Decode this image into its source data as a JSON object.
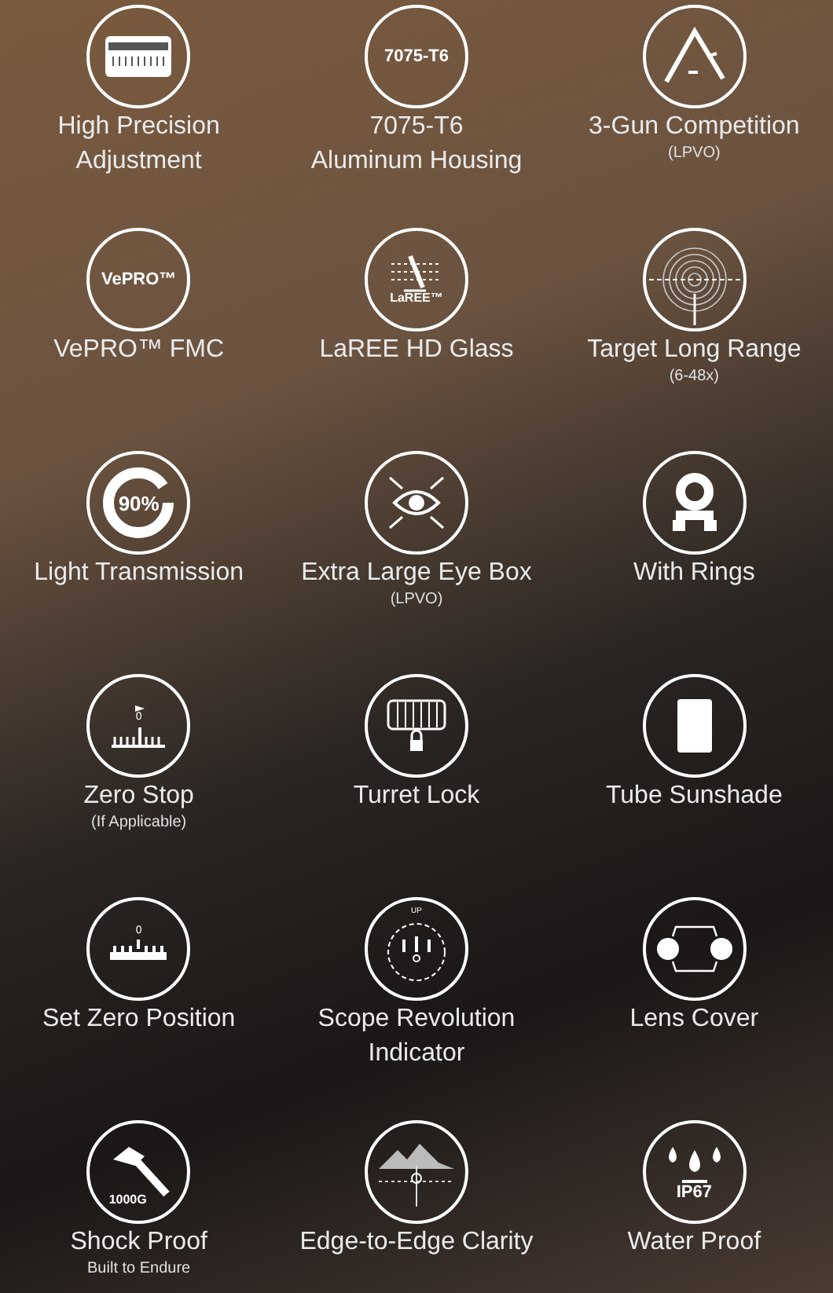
{
  "features": [
    {
      "kind": "ruler",
      "label": "High Precision",
      "label_2": "Adjustment"
    },
    {
      "kind": "text",
      "icon_text": "7075-T6",
      "label": "7075-T6",
      "label_2": "Aluminum Housing"
    },
    {
      "kind": "guns",
      "label": "3-Gun Competition",
      "note": "(LPVO)"
    },
    {
      "kind": "text",
      "icon_text": "VePRO™",
      "label": "VePRO™ FMC"
    },
    {
      "kind": "laree",
      "icon_text": "LaREE™",
      "label": "LaREE HD Glass"
    },
    {
      "kind": "target",
      "label": "Target Long Range",
      "note": "(6-48x)"
    },
    {
      "kind": "ring",
      "icon_text": "90%",
      "label": "Light Transmission"
    },
    {
      "kind": "eye",
      "label": "Extra Large Eye Box",
      "note": "(LPVO)"
    },
    {
      "kind": "mount",
      "label": "With Rings"
    },
    {
      "kind": "zerostop",
      "icon_text": "0",
      "label": "Zero Stop",
      "note": "(If Applicable)"
    },
    {
      "kind": "turret",
      "label": "Turret Lock"
    },
    {
      "kind": "shade",
      "label": "Tube Sunshade"
    },
    {
      "kind": "scale",
      "icon_text": "0",
      "label": "Set Zero Position"
    },
    {
      "kind": "revolution",
      "icon_text": "UP",
      "label": "Scope Revolution",
      "label_2": "Indicator"
    },
    {
      "kind": "cover",
      "label": "Lens Cover"
    },
    {
      "kind": "hammer",
      "icon_text": "1000G",
      "label": "Shock Proof",
      "note": "Built to Endure"
    },
    {
      "kind": "mountain",
      "label": "Edge-to-Edge Clarity"
    },
    {
      "kind": "drops",
      "icon_text": "IP67",
      "label": "Water Proof"
    }
  ]
}
